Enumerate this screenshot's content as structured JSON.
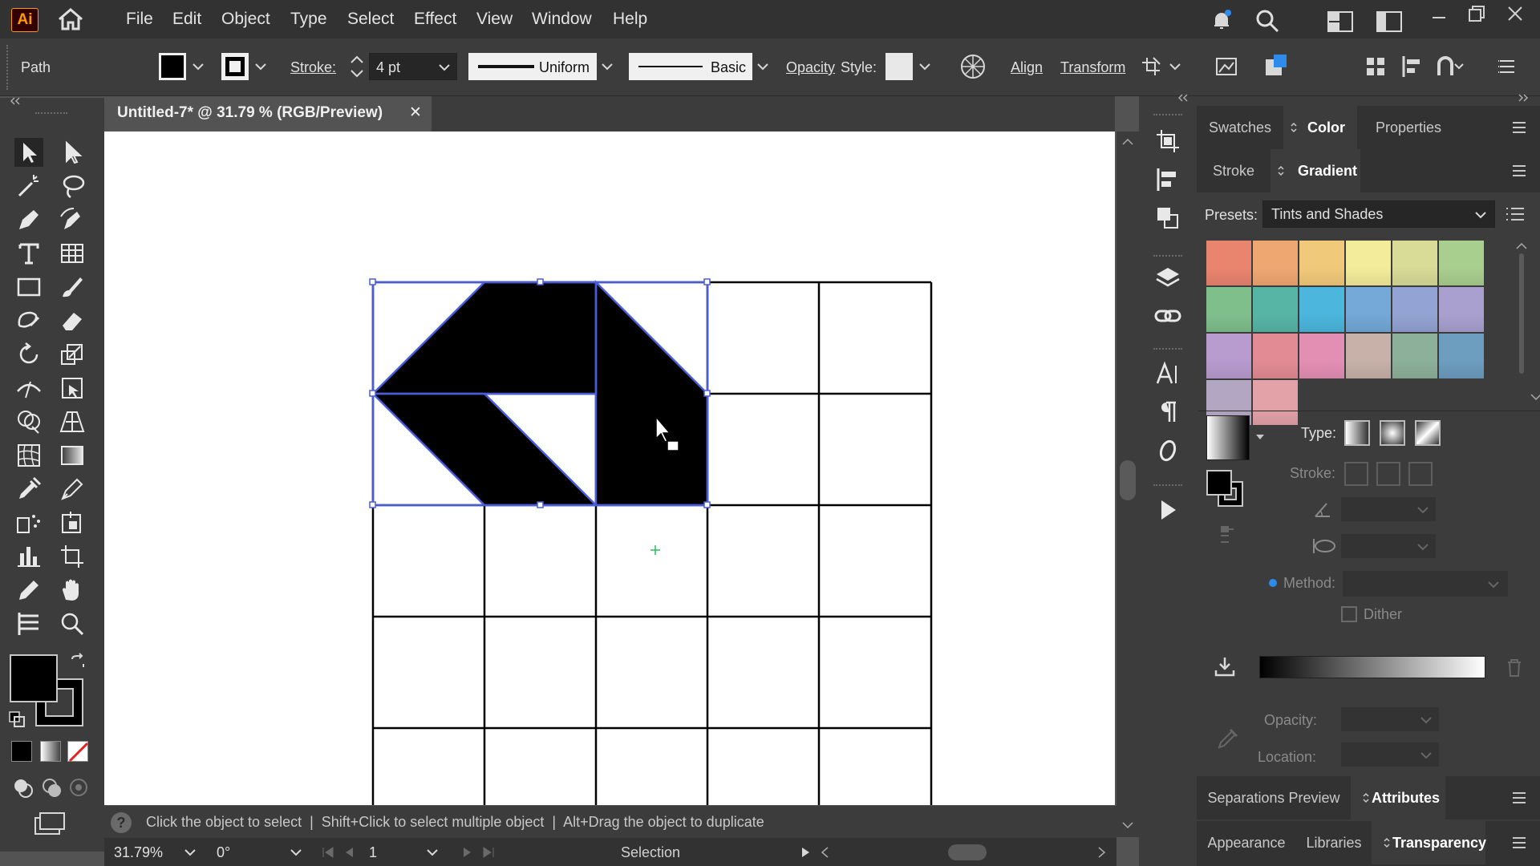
{
  "app": {
    "logo": "Ai"
  },
  "menu": [
    "File",
    "Edit",
    "Object",
    "Type",
    "Select",
    "Effect",
    "View",
    "Window",
    "Help"
  ],
  "control": {
    "selection_type": "Path",
    "stroke_label": "Stroke:",
    "stroke_weight": "4 pt",
    "profile_label": "Uniform",
    "brush_label": "Basic",
    "opacity_label": "Opacity",
    "style_label": "Style:",
    "align_label": "Align",
    "transform_label": "Transform"
  },
  "document": {
    "tab_title": "Untitled-7* @ 31.79 % (RGB/Preview)",
    "close": "✕"
  },
  "status": {
    "hint": "Click the object to select  |  Shift+Click to select multiple object  |  Alt+Drag the object to duplicate",
    "help_icon": "?"
  },
  "bottom": {
    "zoom": "31.79%",
    "rotation": "0°",
    "artboard": "1",
    "mode": "Selection"
  },
  "panels": {
    "top_tabs": [
      "Swatches",
      "Color",
      "Properties"
    ],
    "second_tabs": [
      "Stroke",
      "Gradient"
    ],
    "presets_label": "Presets:",
    "presets_value": "Tints and Shades",
    "type_label": "Type:",
    "stroke_label": "Stroke:",
    "method_label": "Method:",
    "dither_label": "Dither",
    "opacity_label": "Opacity:",
    "location_label": "Location:",
    "bottom_tabs_1": [
      "Separations Preview",
      "Attributes"
    ],
    "bottom_tabs_2": [
      "Appearance",
      "Libraries",
      "Transparency"
    ]
  },
  "swatch_colors": [
    "#e9846f",
    "#efa772",
    "#f1c97a",
    "#f3ec9b",
    "#d8dc97",
    "#a9cf8f",
    "#7fbf8c",
    "#57b5a5",
    "#4cb6dc",
    "#74a9d8",
    "#93a3d3",
    "#a9a0cf",
    "#b89bcf",
    "#e38b95",
    "#e38fb4",
    "#c7b1a8",
    "#8db09a",
    "#6d9dbf",
    "#b2a6c3",
    "#e2a2a8"
  ],
  "colors": {
    "accent": "#4a5dd8",
    "chrome_dark": "#323232",
    "chrome": "#3c3c3c",
    "canvas_bg": "#535353"
  }
}
